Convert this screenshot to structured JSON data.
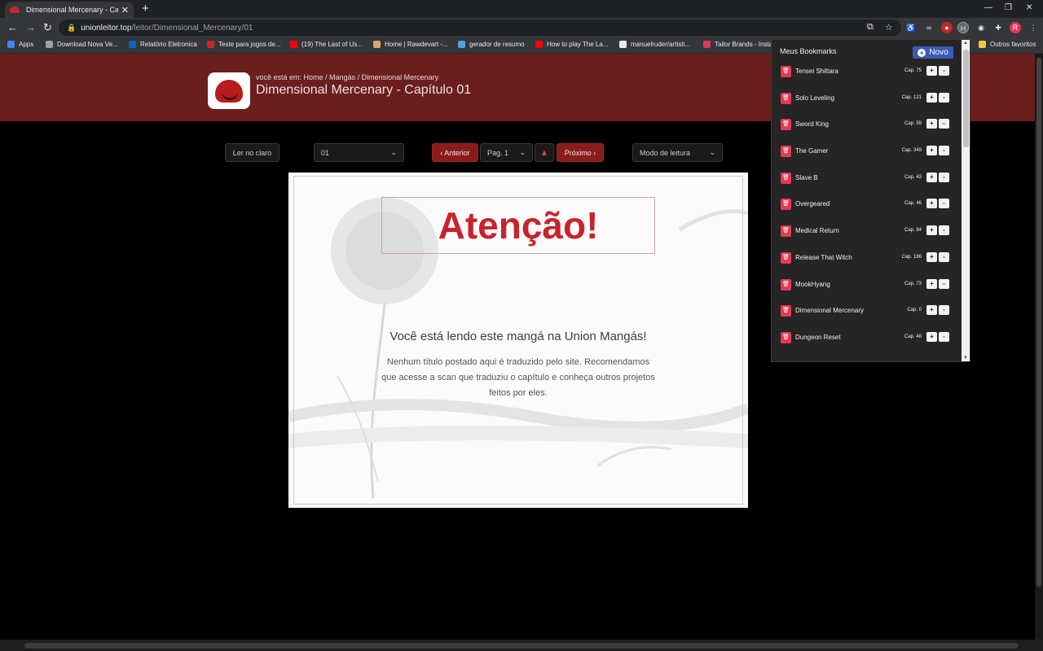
{
  "browser": {
    "tab_title": "Dimensional Mercenary - Capítul",
    "tab_close": "✕",
    "new_tab": "+",
    "url_host": "unionleitor.top",
    "url_path": "/leitor/Dimensional_Mercenary/01",
    "bookmarks_bar": [
      {
        "label": "Apps",
        "color": "#4285f4"
      },
      {
        "label": "Download Nova Ve...",
        "color": "#9aa0a6"
      },
      {
        "label": "Relatório Eletronica",
        "color": "#0a66c2"
      },
      {
        "label": "Teste para jogos de...",
        "color": "#c62828"
      },
      {
        "label": "(19) The Last of Us...",
        "color": "#ff0000"
      },
      {
        "label": "Home | Rawdevart -...",
        "color": "#d7a86e"
      },
      {
        "label": "gerador de resumo",
        "color": "#4fa3e0"
      },
      {
        "label": "How to play The La...",
        "color": "#ff0000"
      },
      {
        "label": "manuelruder/artisti...",
        "color": "#e8eaed"
      },
      {
        "label": "Tailor Brands - Insta...",
        "color": "#e0375c"
      }
    ],
    "other_bookmarks": "Outros favoritos",
    "profile_initial": "R"
  },
  "header": {
    "breadcrumb_prefix": "você está em:",
    "breadcrumb": "Home / Mangás / Dimensional Mercenary",
    "title": "Dimensional Mercenary - Capítulo 01"
  },
  "controls": {
    "light_mode": "Ler no claro",
    "chapter_select": "01",
    "prev": "‹ Anterior",
    "page_select": "Pag. 1",
    "next": "Próximo ›",
    "reading_mode": "Modo de leitura"
  },
  "reader": {
    "attention": "Atenção!",
    "reading_notice": "Você está lendo este mangá na Union Mangás!",
    "disclaimer": "Nenhum título postado aqui é traduzido pelo site. Recomendamos que acesse a scan que traduziu o capítulo e conheça outros projetos feitos por eles."
  },
  "bookmark_popup": {
    "title": "Meus Bookmarks",
    "new_label": "Novo",
    "items": [
      {
        "name": "Tensei Shittara",
        "cap": "Cap. 75"
      },
      {
        "name": "Solo Leveling",
        "cap": "Cap. 121"
      },
      {
        "name": "Sword King",
        "cap": "Cap. 59"
      },
      {
        "name": "The Gamer",
        "cap": "Cap. 349"
      },
      {
        "name": "Slave B",
        "cap": "Cap. 43"
      },
      {
        "name": "Overgeared",
        "cap": "Cap. 46"
      },
      {
        "name": "Medical Return",
        "cap": "Cap. 84"
      },
      {
        "name": "Release That Witch",
        "cap": "Cap. 186"
      },
      {
        "name": "MookHyang",
        "cap": "Cap. 73"
      },
      {
        "name": "Dimensional Mercenary",
        "cap": "Cap. 0"
      },
      {
        "name": "Dungeon Reset",
        "cap": "Cap. 48"
      }
    ]
  }
}
